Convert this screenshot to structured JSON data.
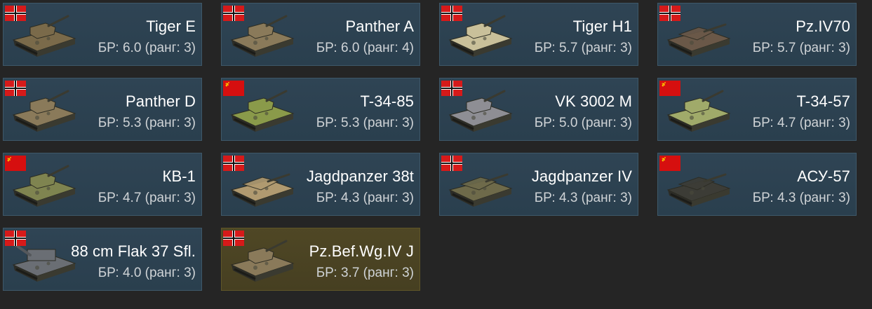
{
  "colors": {
    "background": "#252525",
    "card_bg": "#2d4252",
    "card_border": "#3e5869",
    "selected_card_bg": "#4b4423",
    "name_text": "#ffffff",
    "br_text": "#cfd3d6",
    "germany_flag_red": "#d61a1a",
    "ussr_flag_red": "#d60f0f",
    "ussr_emblem": "#ffd700"
  },
  "vehicles": [
    {
      "name": "Tiger E",
      "br": "БР: 6.0 (ранг: 3)",
      "nation": "germany",
      "icon": "tank-icon",
      "camo": "#7a6a4a",
      "selected": false
    },
    {
      "name": "Panther A",
      "br": "БР: 6.0 (ранг: 4)",
      "nation": "germany",
      "icon": "tank-icon",
      "camo": "#8a7a5a",
      "selected": false
    },
    {
      "name": "Tiger H1",
      "br": "БР: 5.7 (ранг: 3)",
      "nation": "germany",
      "icon": "tank-icon",
      "camo": "#c9c09a",
      "selected": false
    },
    {
      "name": "Pz.IV70",
      "br": "БР: 5.7 (ранг: 3)",
      "nation": "germany",
      "icon": "tank-destroyer-icon",
      "camo": "#6a5848",
      "selected": false
    },
    {
      "name": "Panther D",
      "br": "БР: 5.3 (ранг: 3)",
      "nation": "germany",
      "icon": "tank-icon",
      "camo": "#8a7a5a",
      "selected": false
    },
    {
      "name": "T-34-85",
      "br": "БР: 5.3 (ранг: 3)",
      "nation": "ussr",
      "icon": "tank-icon",
      "camo": "#8a9a4a",
      "selected": false
    },
    {
      "name": "VK 3002 M",
      "br": "БР: 5.0 (ранг: 3)",
      "nation": "germany",
      "icon": "tank-icon",
      "camo": "#8e8e94",
      "selected": false
    },
    {
      "name": "T-34-57",
      "br": "БР: 4.7 (ранг: 3)",
      "nation": "ussr",
      "icon": "tank-icon",
      "camo": "#a0aa6a",
      "selected": false
    },
    {
      "name": "КВ-1",
      "br": "БР: 4.7 (ранг: 3)",
      "nation": "ussr",
      "icon": "tank-icon",
      "camo": "#7f8450",
      "selected": false
    },
    {
      "name": "Jagdpanzer 38t",
      "br": "БР: 4.3 (ранг: 3)",
      "nation": "germany",
      "icon": "tank-destroyer-icon",
      "camo": "#b09a70",
      "selected": false
    },
    {
      "name": "Jagdpanzer IV",
      "br": "БР: 4.3 (ранг: 3)",
      "nation": "germany",
      "icon": "tank-destroyer-icon",
      "camo": "#6e6a4a",
      "selected": false
    },
    {
      "name": "АСУ-57",
      "br": "БР: 4.3 (ранг: 3)",
      "nation": "ussr",
      "icon": "tank-destroyer-icon",
      "camo": "#3c3c36",
      "selected": false
    },
    {
      "name": "88 cm Flak 37 Sfl.",
      "br": "БР: 4.0 (ранг: 3)",
      "nation": "germany",
      "icon": "spaa-icon",
      "camo": "#6a6e74",
      "selected": false
    },
    {
      "name": "Pz.Bef.Wg.IV J",
      "br": "БР: 3.7 (ранг: 3)",
      "nation": "germany",
      "icon": "tank-icon",
      "camo": "#8a7a5a",
      "selected": true
    }
  ]
}
